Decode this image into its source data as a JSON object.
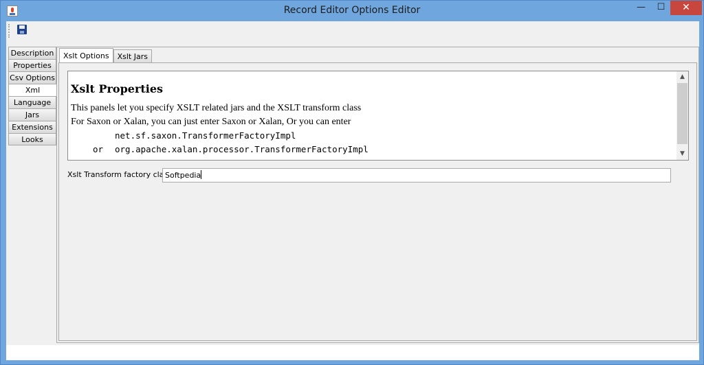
{
  "window": {
    "title": "Record Editor Options Editor",
    "controls": {
      "minimize": "—",
      "maximize": "☐",
      "close": "✕"
    }
  },
  "toolbar": {
    "save_icon": "save-disk-icon"
  },
  "side_tabs": [
    {
      "label": "Description",
      "active": false
    },
    {
      "label": "Properties",
      "active": false
    },
    {
      "label": "Csv Options",
      "active": false
    },
    {
      "label": "Xml",
      "active": true
    },
    {
      "label": "Language",
      "active": false
    },
    {
      "label": "Jars",
      "active": false
    },
    {
      "label": "Extensions",
      "active": false
    },
    {
      "label": "Looks",
      "active": false
    }
  ],
  "inner_tabs": [
    {
      "label": "Xslt Options",
      "active": true
    },
    {
      "label": "Xslt Jars",
      "active": false
    }
  ],
  "help": {
    "heading": "Xslt Properties",
    "line1": "This panels let you specify XSLT related jars and the XSLT transform class",
    "line2": "For Saxon or Xalan, you can just enter Saxon or Xalan, Or you can enter",
    "code1_prefix": "",
    "code1": "net.sf.saxon.TransformerFactoryImpl",
    "code2_prefix": "or",
    "code2": "org.apache.xalan.processor.TransformerFactoryImpl"
  },
  "transform_field": {
    "label": "Xslt Transform factory class",
    "value": "Softpedia"
  },
  "colors": {
    "titlebar": "#6fa6dd",
    "close_button": "#c7463d",
    "panel": "#f0f0f0"
  }
}
